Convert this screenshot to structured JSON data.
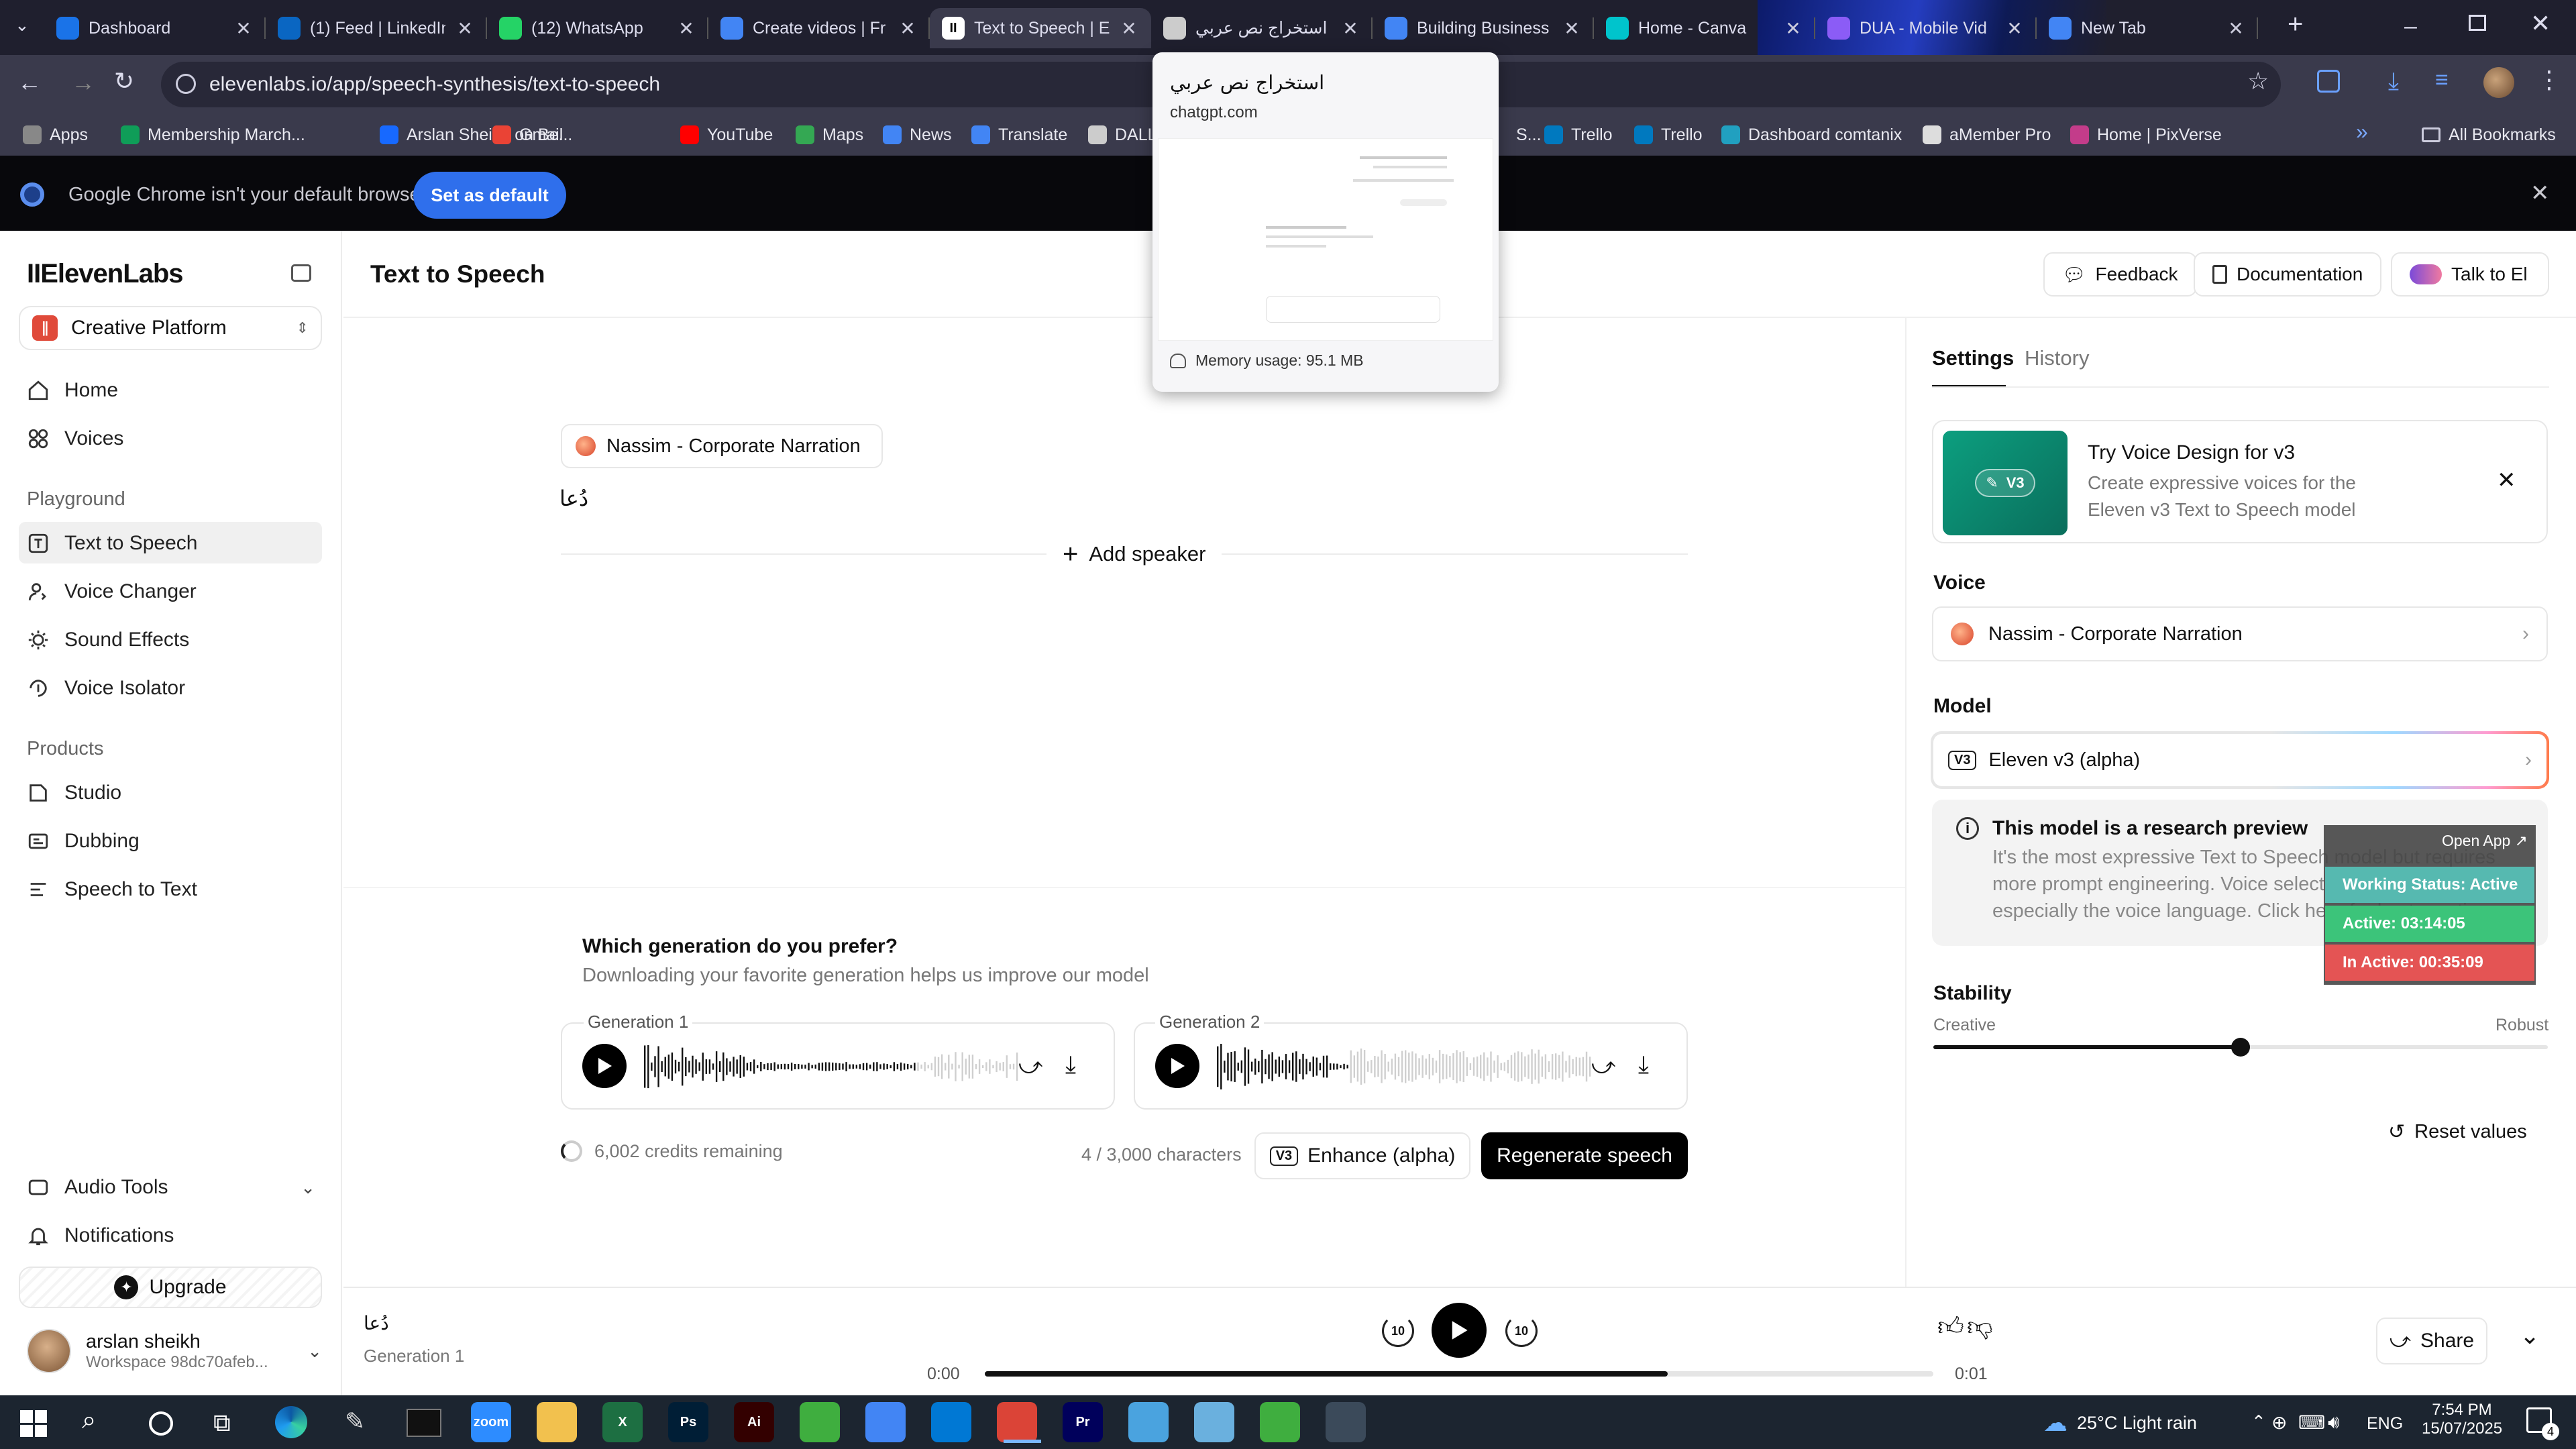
{
  "browser": {
    "tabs": [
      {
        "title": "Dashboard",
        "icon": "dashboard-icon",
        "color": "#1a73e8"
      },
      {
        "title": "(1) Feed | LinkedIn",
        "icon": "linkedin-icon",
        "color": "#0a66c2"
      },
      {
        "title": "(12) WhatsApp",
        "icon": "whatsapp-icon",
        "color": "#25d366"
      },
      {
        "title": "Create videos | Fr",
        "icon": "doc-icon",
        "color": "#4285f4"
      },
      {
        "title": "Text to Speech | El",
        "icon": "elevenlabs-icon",
        "color": "#ffffff"
      },
      {
        "title": "استخراج نص عربي",
        "icon": "chatgpt-icon",
        "color": "#cccccc"
      },
      {
        "title": "Building Business",
        "icon": "doc-icon",
        "color": "#4285f4"
      },
      {
        "title": "Home - Canva",
        "icon": "canva-icon",
        "color": "#00c4cc"
      },
      {
        "title": "DUA - Mobile Vid",
        "icon": "video-icon",
        "color": "#8b5cf6"
      },
      {
        "title": "New Tab",
        "icon": "chrome-icon",
        "color": "#4285f4"
      }
    ],
    "url": "elevenlabs.io/app/speech-synthesis/text-to-speech",
    "bookmarks": [
      {
        "label": "Apps",
        "color": "#888888"
      },
      {
        "label": "Membership March...",
        "color": "#0f9d58"
      },
      {
        "label": "Arslan Sheikh on Be...",
        "color": "#1769ff"
      },
      {
        "label": "Gmail",
        "color": "#ea4335"
      },
      {
        "label": "YouTube",
        "color": "#ff0000"
      },
      {
        "label": "Maps",
        "color": "#34a853"
      },
      {
        "label": "News",
        "color": "#4285f4"
      },
      {
        "label": "Translate",
        "color": "#4285f4"
      },
      {
        "label": "DALL",
        "color": "#cccccc"
      },
      {
        "label": "S...",
        "color": "#3a3a4c"
      },
      {
        "label": "Trello",
        "color": "#0079bf"
      },
      {
        "label": "Trello",
        "color": "#0079bf"
      },
      {
        "label": "Dashboard comtanix",
        "color": "#21a0c0"
      },
      {
        "label": "aMember Pro",
        "color": "#dddddd"
      },
      {
        "label": "Home | PixVerse",
        "color": "#c33c8a"
      }
    ],
    "all_bookmarks": "All Bookmarks",
    "infobar": {
      "message": "Google Chrome isn't your default browser",
      "button": "Set as default"
    },
    "tab_preview": {
      "title": "استخراج نص عربي",
      "domain": "chatgpt.com",
      "memory": "Memory usage: 95.1 MB"
    }
  },
  "sidebar": {
    "brand": "IIElevenLabs",
    "workspace": "Creative Platform",
    "top_items": [
      "Home",
      "Voices"
    ],
    "playground_title": "Playground",
    "playground_items": [
      "Text to Speech",
      "Voice Changer",
      "Sound Effects",
      "Voice Isolator"
    ],
    "products_title": "Products",
    "products_items": [
      "Studio",
      "Dubbing",
      "Speech to Text"
    ],
    "audio_tools": "Audio Tools",
    "notifications": "Notifications",
    "upgrade": "Upgrade",
    "user": {
      "name": "arslan sheikh",
      "workspace": "Workspace 98dc70afeb..."
    }
  },
  "header": {
    "title": "Text to Speech",
    "feedback": "Feedback",
    "documentation": "Documentation",
    "talk": "Talk to El"
  },
  "editor": {
    "speaker": "Nassim - Corporate Narration",
    "text": "دُعا",
    "add_speaker": "Add speaker"
  },
  "generation": {
    "question": "Which generation do you prefer?",
    "subtitle": "Downloading your favorite generation helps us improve our model",
    "gen1_label": "Generation 1",
    "gen2_label": "Generation 2",
    "gen1_progress": 0.72,
    "gen2_progress": 0.35,
    "credits": "6,002 credits remaining",
    "chars": "4 / 3,000 characters",
    "enhance_badge": "V3",
    "enhance": "Enhance (alpha)",
    "regenerate": "Regenerate speech"
  },
  "settings": {
    "tabs": [
      "Settings",
      "History"
    ],
    "promo": {
      "badge": "V3",
      "title": "Try Voice Design for v3",
      "desc_line1": "Create expressive voices for the",
      "desc_line2": "Eleven v3 Text to Speech model"
    },
    "voice_label": "Voice",
    "voice": "Nassim - Corporate Narration",
    "model_label": "Model",
    "model_badge": "V3",
    "model": "Eleven v3 (alpha)",
    "notice_title": "This model is a research preview",
    "notice_line1": "It's the most expressive Text to Speech model but requires",
    "notice_line2": "more prompt engineering. Voice selection matters,",
    "notice_line3": "especially the voice language. Click here for best practices.",
    "stability_label": "Stability",
    "stability_left": "Creative",
    "stability_right": "Robust",
    "stability_value": 0.5,
    "reset": "Reset values"
  },
  "overlay": {
    "open_app": "Open App ↗",
    "working": "Working Status: Active",
    "active": "Active: 03:14:05",
    "inactive": "In Active: 00:35:09"
  },
  "player": {
    "text": "دُعا",
    "label": "Generation 1",
    "time_start": "0:00",
    "time_end": "0:01",
    "progress": 0.72,
    "rewind": "10",
    "forward": "10",
    "share": "Share"
  },
  "taskbar": {
    "weather": "25°C  Light rain",
    "lang": "ENG",
    "time": "7:54 PM",
    "date": "15/07/2025",
    "notif_count": "4",
    "apps": [
      {
        "name": "zoom-icon",
        "label": "zoom",
        "color": "#2d8cff"
      },
      {
        "name": "file-explorer-icon",
        "label": "",
        "color": "#f2c14e"
      },
      {
        "name": "excel-icon",
        "label": "X",
        "color": "#1d6f42"
      },
      {
        "name": "photoshop-icon",
        "label": "Ps",
        "color": "#001e36"
      },
      {
        "name": "illustrator-icon",
        "label": "Ai",
        "color": "#330000"
      },
      {
        "name": "app-green-icon",
        "label": "",
        "color": "#3fae3f"
      },
      {
        "name": "chrome-icon",
        "label": "",
        "color": "#4285f4"
      },
      {
        "name": "vscode-icon",
        "label": "",
        "color": "#0078d4"
      },
      {
        "name": "chrome-profile-icon",
        "label": "",
        "color": "#db4437"
      },
      {
        "name": "premiere-icon",
        "label": "Pr",
        "color": "#00005b"
      },
      {
        "name": "app-cube-icon",
        "label": "",
        "color": "#4aa3df"
      },
      {
        "name": "app-blue-icon",
        "label": "",
        "color": "#6ab0de"
      },
      {
        "name": "app-green2-icon",
        "label": "",
        "color": "#3fae3f"
      },
      {
        "name": "calculator-icon",
        "label": "",
        "color": "#3b4a5a"
      }
    ]
  }
}
